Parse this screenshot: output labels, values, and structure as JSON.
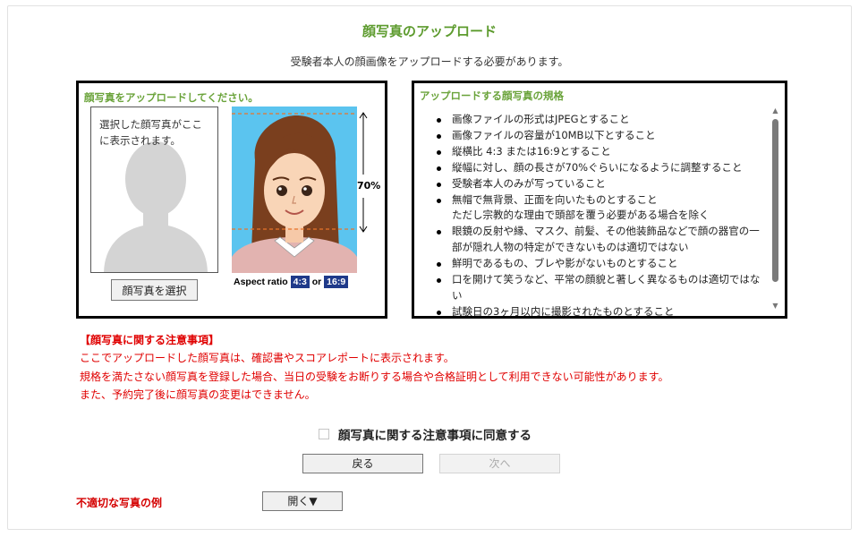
{
  "page": {
    "title": "顔写真のアップロード",
    "subtitle": "受験者本人の顔画像をアップロードする必要があります。"
  },
  "upload_panel": {
    "heading": "顔写真をアップロードしてください。",
    "preview_text": "選択した顔写真がここに表示されます。",
    "select_button_label": "顔写真を選択",
    "sample_percent_label": "70%",
    "aspect_prefix": "Aspect ratio",
    "aspect_ratio_1": "4:3",
    "aspect_or": "or",
    "aspect_ratio_2": "16:9",
    "sample_bg_color": "#5bc4ef",
    "guide_color": "#e8742a"
  },
  "rules_panel": {
    "heading": "アップロードする顔写真の規格",
    "rules": [
      {
        "text": "画像ファイルの形式はJPEGとすること",
        "sub": ""
      },
      {
        "text": "画像ファイルの容量が10MB以下とすること",
        "sub": ""
      },
      {
        "text": "縦横比 4:3 または16:9とすること",
        "sub": ""
      },
      {
        "text": "縦幅に対し、顔の長さが70%ぐらいになるように調整すること",
        "sub": ""
      },
      {
        "text": "受験者本人のみが写っていること",
        "sub": ""
      },
      {
        "text": "無帽で無背景、正面を向いたものとすること",
        "sub": "ただし宗教的な理由で頭部を覆う必要がある場合を除く"
      },
      {
        "text": "眼鏡の反射や縁、マスク、前髪、その他装飾品などで顔の器官の一部が隠れ人物の特定ができないものは適切ではない",
        "sub": ""
      },
      {
        "text": "鮮明であるもの、ブレや影がないものとすること",
        "sub": ""
      },
      {
        "text": "口を開けて笑うなど、平常の顔貌と著しく異なるものは適切ではない",
        "sub": ""
      },
      {
        "text": "試験日の3ヶ月以内に撮影されたものとすること",
        "sub": ""
      }
    ],
    "scroll_up_icon": "▲",
    "scroll_down_icon": "▼"
  },
  "notice": {
    "heading": "【顔写真に関する注意事項】",
    "lines": [
      "ここでアップロードした顔写真は、確認書やスコアレポートに表示されます。",
      "規格を満たさない顔写真を登録した場合、当日の受験をお断りする場合や合格証明として利用できない可能性があります。",
      "また、予約完了後に顔写真の変更はできません。"
    ],
    "color": "#e00000"
  },
  "agreement": {
    "label": "顔写真に関する注意事項に同意する",
    "checked": false
  },
  "navigation": {
    "back_label": "戻る",
    "next_label": "次へ",
    "next_enabled": false
  },
  "bad_examples": {
    "label": "不適切な写真の例",
    "open_button_label": "開く▼"
  },
  "colors": {
    "title_green": "#5d9b2e",
    "heading_green": "#6aa33a",
    "warning_red": "#d40000"
  }
}
